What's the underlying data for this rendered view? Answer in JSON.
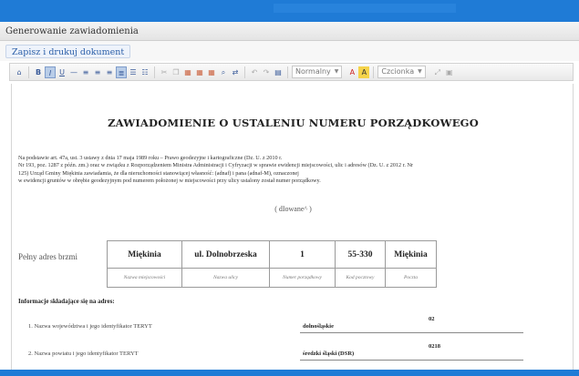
{
  "panel": {
    "title": "Generowanie zawiadomienia"
  },
  "actions": {
    "save_print": "Zapisz i drukuj dokument"
  },
  "toolbar": {
    "style_combo": "Normalny",
    "font_combo": "Czcionka",
    "text_color_label": "A",
    "bg_color_label": "A",
    "buttons": [
      {
        "icon": "source-icon",
        "glyph": "⌂"
      },
      {
        "icon": "bold-icon",
        "glyph": "B"
      },
      {
        "icon": "italic-icon",
        "glyph": "I"
      },
      {
        "icon": "underline-icon",
        "glyph": "U"
      },
      {
        "icon": "strike-icon",
        "glyph": "S"
      },
      {
        "icon": "align-left-icon",
        "glyph": "≡"
      },
      {
        "icon": "align-center-icon",
        "glyph": "≡"
      },
      {
        "icon": "align-right-icon",
        "glyph": "≡"
      },
      {
        "icon": "justify-icon",
        "glyph": "≣"
      },
      {
        "icon": "numbered-list-icon",
        "glyph": "☰"
      },
      {
        "icon": "bullet-list-icon",
        "glyph": "☷"
      }
    ]
  },
  "document": {
    "title": "ZAWIADOMIENIE O USTALENIU NUMERU PORZĄDKOWEGO",
    "legal_lines": [
      "Na podstawie art. 47a, ust. 3 ustawy z dnia 17 maja 1989 roku – Prawo geodezyjne i kartograficzne (Dz. U. z 2010 r.",
      "Nr 193, poz. 1287 z późn. zm.) oraz w związku z Rozporządzeniem Ministra Administracji i Cyfryzacji w sprawie ewidencji miejscowości, ulic i adresów (Dz. U. z 2012 r. Nr",
      "125) Urząd Gminy Miękinia zawiadamia, że dla nieruchomości stanowiącej własność: (adnaf) i pana (adnaf-M), oznaczonej",
      "w ewidencji gruntów w obrębie geodezyjnym pod numerem położonej w miejscowości przy ulicy ustalony został numer porządkowy."
    ],
    "placeholder": "( dIowane^ )",
    "full_address_label": "Pełny adres brzmi",
    "address_values": [
      "Miękinia",
      "ul. Dolnobrzeska",
      "1",
      "55-330",
      "Miękinia"
    ],
    "address_captions": [
      "Nazwa miejscowości",
      "Nazwa ulicy",
      "Numer porządkowy",
      "Kod pocztowy",
      "Poczta"
    ],
    "info_heading": "Informacje składające się na adres:",
    "info_rows": [
      {
        "label": "1. Nazwa województwa i jego identyfikator TERYT",
        "value": "dolnośląskie",
        "code": "02"
      },
      {
        "label": "2. Nazwa powiatu i jego identyfikator TERYT",
        "value": "średzki śląski (DSR)",
        "code": "0218"
      }
    ]
  },
  "colors": {
    "accent": "#1f7bd6",
    "link": "#2a5ea8"
  }
}
